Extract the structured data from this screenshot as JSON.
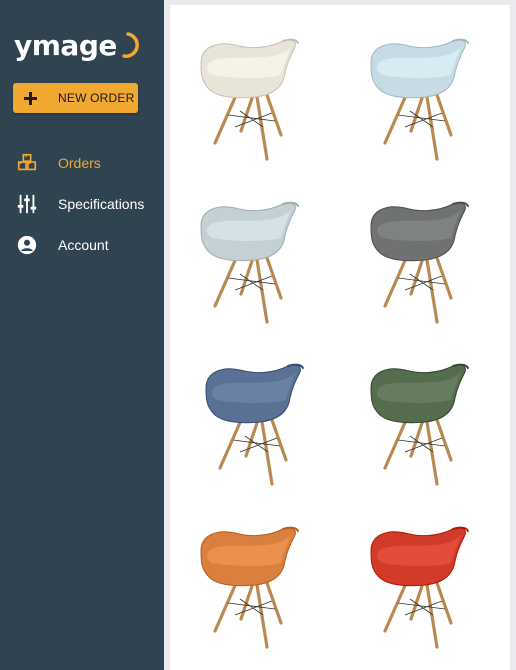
{
  "app": {
    "logo_text": "ymage",
    "accent_color": "#f0a830",
    "sidebar_color": "#2f4450"
  },
  "sidebar": {
    "new_order_label": "NEW ORDER",
    "items": [
      {
        "label": "Orders",
        "icon": "boxes-icon",
        "active": true
      },
      {
        "label": "Specifications",
        "icon": "sliders-icon",
        "active": false
      },
      {
        "label": "Account",
        "icon": "account-circle-icon",
        "active": false
      }
    ]
  },
  "gallery": {
    "items": [
      {
        "name": "chair-cream",
        "color": "#e8e4d8"
      },
      {
        "name": "chair-light-blue",
        "color": "#c6dbe3"
      },
      {
        "name": "chair-light-grey",
        "color": "#c4d0d4"
      },
      {
        "name": "chair-dark-grey",
        "color": "#6f7172"
      },
      {
        "name": "chair-blue",
        "color": "#5a7095"
      },
      {
        "name": "chair-green",
        "color": "#566c4f"
      },
      {
        "name": "chair-orange",
        "color": "#d9803f"
      },
      {
        "name": "chair-red",
        "color": "#d23b2a"
      }
    ]
  }
}
